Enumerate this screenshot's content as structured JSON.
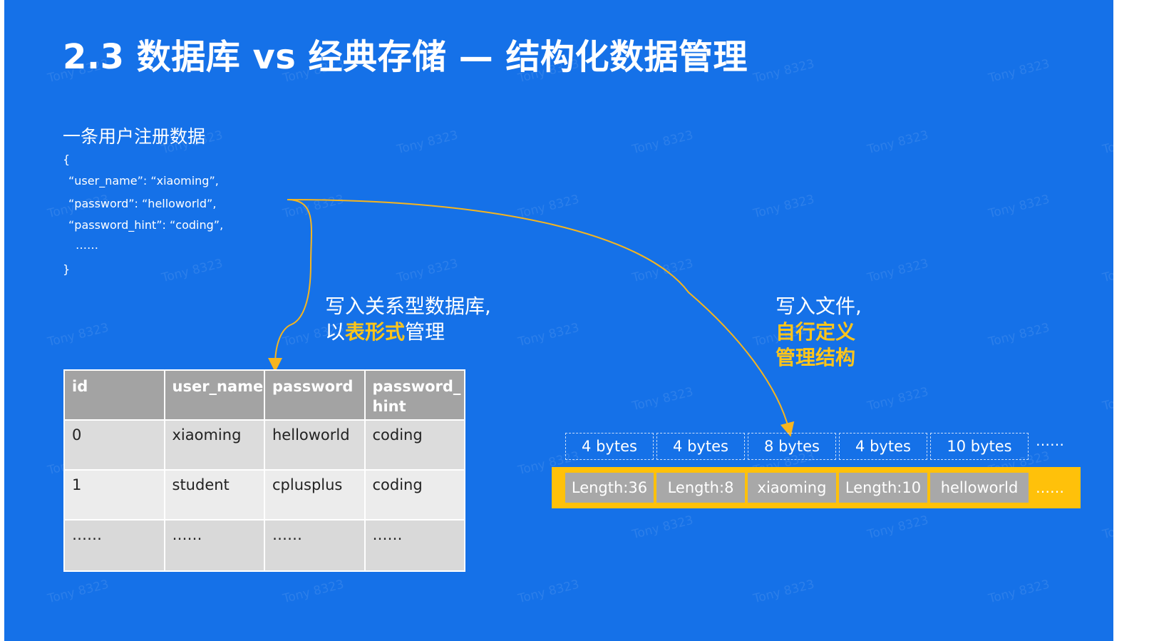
{
  "title": "2.3 数据库 vs 经典存储 — 结构化数据管理",
  "record": {
    "heading": "一条用户注册数据",
    "open_brace": "{",
    "lines": [
      "“user_name”: “xiaoming”,",
      "“password”: “helloworld”,",
      "“password_hint”: “coding”,",
      "……"
    ],
    "close_brace": "}"
  },
  "db_caption": {
    "line1": "写入关系型数据库,",
    "line2_prefix": "以",
    "line2_accent": "表形式",
    "line2_suffix": "管理"
  },
  "file_caption": {
    "line1": "写入文件,",
    "line2": "自行定义",
    "line3": "管理结构"
  },
  "table": {
    "headers": [
      "id",
      "user_name",
      "password",
      "password_\nhint"
    ],
    "rows": [
      [
        "0",
        "xiaoming",
        "helloworld",
        "coding"
      ],
      [
        "1",
        "student",
        "cplusplus",
        "coding"
      ],
      [
        "……",
        "……",
        "……",
        "……"
      ]
    ]
  },
  "file_layout": {
    "byte_labels": [
      "4 bytes",
      "4 bytes",
      "8 bytes",
      "4 bytes",
      "10 bytes"
    ],
    "byte_more": "……",
    "cells": [
      "Length:36",
      "Length:8",
      "xiaoming",
      "Length:10",
      "helloworld"
    ],
    "cell_more": "……"
  },
  "watermark": "Tony 8323",
  "colors": {
    "background": "#1571e8",
    "accent": "#ffc51a",
    "arrow": "#f6b51e",
    "file_bar": "#ffc10a",
    "cell_gray": "#a8a8a8"
  }
}
